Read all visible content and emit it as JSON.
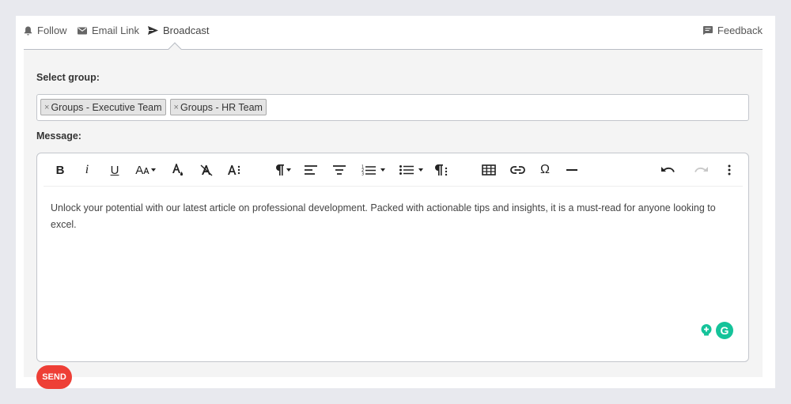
{
  "tabs": {
    "follow": "Follow",
    "email_link": "Email Link",
    "broadcast": "Broadcast",
    "feedback": "Feedback"
  },
  "form": {
    "select_group_label": "Select group:",
    "groups": [
      "Groups - Executive Team",
      "Groups - HR Team"
    ],
    "chip_remove": "×",
    "message_label": "Message:",
    "message_text": "Unlock your potential with our latest article on professional development. Packed with actionable tips and insights, it is a must-read for anyone looking to excel."
  },
  "toolbar": {
    "bold": "B",
    "italic": "i",
    "underline": "U",
    "font_size": "Aᴀ",
    "special_char": "Ω"
  },
  "grammarly": {
    "logo": "G"
  },
  "send_label": "SEND",
  "colors": {
    "send": "#ee3f36",
    "grammarly": "#15c39a",
    "panel": "#f4f4f4",
    "page": "#e8e9ee"
  }
}
